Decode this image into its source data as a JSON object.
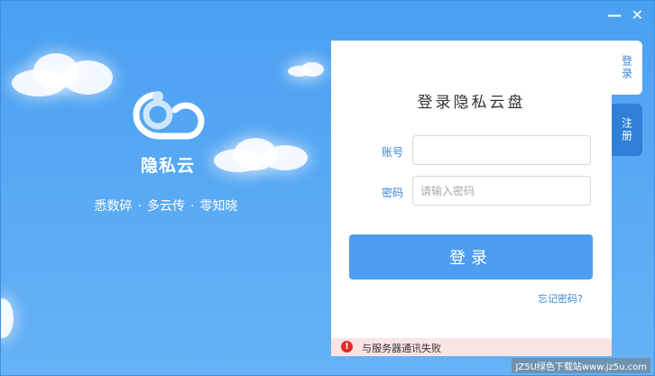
{
  "window": {
    "minimize_glyph": "—",
    "close_glyph": "✕"
  },
  "brand": {
    "name": "隐私云",
    "slogan_parts": [
      "悉数碎",
      "多云传",
      "零知晓"
    ],
    "slogan_separator": "·"
  },
  "login": {
    "title": "登录隐私云盘",
    "account_label": "账号",
    "account_value": "",
    "password_label": "密码",
    "password_placeholder": "请输入密码",
    "submit_label": "登录",
    "forgot_label": "忘记密码?"
  },
  "tabs": [
    {
      "label": "登录",
      "active": true
    },
    {
      "label": "注册",
      "active": false
    }
  ],
  "status": {
    "icon": "error-icon",
    "message": "与服务器通讯失败"
  },
  "watermark": "JZ5U绿色下载站www.jz5u.com",
  "colors": {
    "background": "#4aa0f2",
    "primary_button": "#4d9ef0",
    "active_tab": "#ffffff",
    "inactive_tab": "#2f7fd6",
    "error_bar": "#fbe4e4",
    "error_icon": "#e02a2a"
  }
}
